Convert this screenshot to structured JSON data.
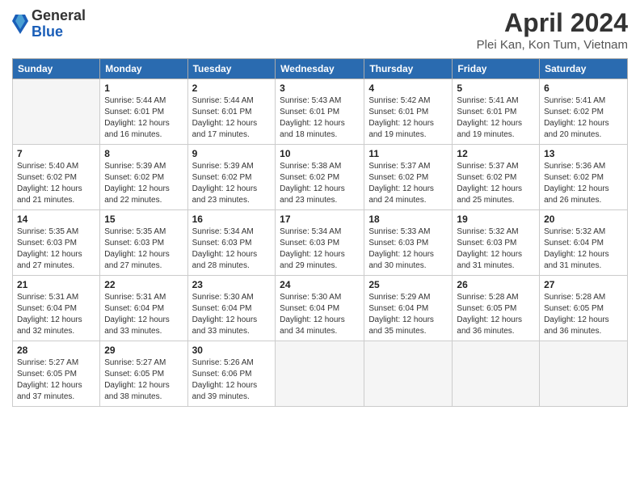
{
  "logo": {
    "line1": "General",
    "line2": "Blue"
  },
  "title": "April 2024",
  "subtitle": "Plei Kan, Kon Tum, Vietnam",
  "calendar": {
    "headers": [
      "Sunday",
      "Monday",
      "Tuesday",
      "Wednesday",
      "Thursday",
      "Friday",
      "Saturday"
    ],
    "weeks": [
      [
        {
          "day": "",
          "info": ""
        },
        {
          "day": "1",
          "info": "Sunrise: 5:44 AM\nSunset: 6:01 PM\nDaylight: 12 hours\nand 16 minutes."
        },
        {
          "day": "2",
          "info": "Sunrise: 5:44 AM\nSunset: 6:01 PM\nDaylight: 12 hours\nand 17 minutes."
        },
        {
          "day": "3",
          "info": "Sunrise: 5:43 AM\nSunset: 6:01 PM\nDaylight: 12 hours\nand 18 minutes."
        },
        {
          "day": "4",
          "info": "Sunrise: 5:42 AM\nSunset: 6:01 PM\nDaylight: 12 hours\nand 19 minutes."
        },
        {
          "day": "5",
          "info": "Sunrise: 5:41 AM\nSunset: 6:01 PM\nDaylight: 12 hours\nand 19 minutes."
        },
        {
          "day": "6",
          "info": "Sunrise: 5:41 AM\nSunset: 6:02 PM\nDaylight: 12 hours\nand 20 minutes."
        }
      ],
      [
        {
          "day": "7",
          "info": "Sunrise: 5:40 AM\nSunset: 6:02 PM\nDaylight: 12 hours\nand 21 minutes."
        },
        {
          "day": "8",
          "info": "Sunrise: 5:39 AM\nSunset: 6:02 PM\nDaylight: 12 hours\nand 22 minutes."
        },
        {
          "day": "9",
          "info": "Sunrise: 5:39 AM\nSunset: 6:02 PM\nDaylight: 12 hours\nand 23 minutes."
        },
        {
          "day": "10",
          "info": "Sunrise: 5:38 AM\nSunset: 6:02 PM\nDaylight: 12 hours\nand 23 minutes."
        },
        {
          "day": "11",
          "info": "Sunrise: 5:37 AM\nSunset: 6:02 PM\nDaylight: 12 hours\nand 24 minutes."
        },
        {
          "day": "12",
          "info": "Sunrise: 5:37 AM\nSunset: 6:02 PM\nDaylight: 12 hours\nand 25 minutes."
        },
        {
          "day": "13",
          "info": "Sunrise: 5:36 AM\nSunset: 6:02 PM\nDaylight: 12 hours\nand 26 minutes."
        }
      ],
      [
        {
          "day": "14",
          "info": "Sunrise: 5:35 AM\nSunset: 6:03 PM\nDaylight: 12 hours\nand 27 minutes."
        },
        {
          "day": "15",
          "info": "Sunrise: 5:35 AM\nSunset: 6:03 PM\nDaylight: 12 hours\nand 27 minutes."
        },
        {
          "day": "16",
          "info": "Sunrise: 5:34 AM\nSunset: 6:03 PM\nDaylight: 12 hours\nand 28 minutes."
        },
        {
          "day": "17",
          "info": "Sunrise: 5:34 AM\nSunset: 6:03 PM\nDaylight: 12 hours\nand 29 minutes."
        },
        {
          "day": "18",
          "info": "Sunrise: 5:33 AM\nSunset: 6:03 PM\nDaylight: 12 hours\nand 30 minutes."
        },
        {
          "day": "19",
          "info": "Sunrise: 5:32 AM\nSunset: 6:03 PM\nDaylight: 12 hours\nand 31 minutes."
        },
        {
          "day": "20",
          "info": "Sunrise: 5:32 AM\nSunset: 6:04 PM\nDaylight: 12 hours\nand 31 minutes."
        }
      ],
      [
        {
          "day": "21",
          "info": "Sunrise: 5:31 AM\nSunset: 6:04 PM\nDaylight: 12 hours\nand 32 minutes."
        },
        {
          "day": "22",
          "info": "Sunrise: 5:31 AM\nSunset: 6:04 PM\nDaylight: 12 hours\nand 33 minutes."
        },
        {
          "day": "23",
          "info": "Sunrise: 5:30 AM\nSunset: 6:04 PM\nDaylight: 12 hours\nand 33 minutes."
        },
        {
          "day": "24",
          "info": "Sunrise: 5:30 AM\nSunset: 6:04 PM\nDaylight: 12 hours\nand 34 minutes."
        },
        {
          "day": "25",
          "info": "Sunrise: 5:29 AM\nSunset: 6:04 PM\nDaylight: 12 hours\nand 35 minutes."
        },
        {
          "day": "26",
          "info": "Sunrise: 5:28 AM\nSunset: 6:05 PM\nDaylight: 12 hours\nand 36 minutes."
        },
        {
          "day": "27",
          "info": "Sunrise: 5:28 AM\nSunset: 6:05 PM\nDaylight: 12 hours\nand 36 minutes."
        }
      ],
      [
        {
          "day": "28",
          "info": "Sunrise: 5:27 AM\nSunset: 6:05 PM\nDaylight: 12 hours\nand 37 minutes."
        },
        {
          "day": "29",
          "info": "Sunrise: 5:27 AM\nSunset: 6:05 PM\nDaylight: 12 hours\nand 38 minutes."
        },
        {
          "day": "30",
          "info": "Sunrise: 5:26 AM\nSunset: 6:06 PM\nDaylight: 12 hours\nand 39 minutes."
        },
        {
          "day": "",
          "info": ""
        },
        {
          "day": "",
          "info": ""
        },
        {
          "day": "",
          "info": ""
        },
        {
          "day": "",
          "info": ""
        }
      ]
    ]
  }
}
